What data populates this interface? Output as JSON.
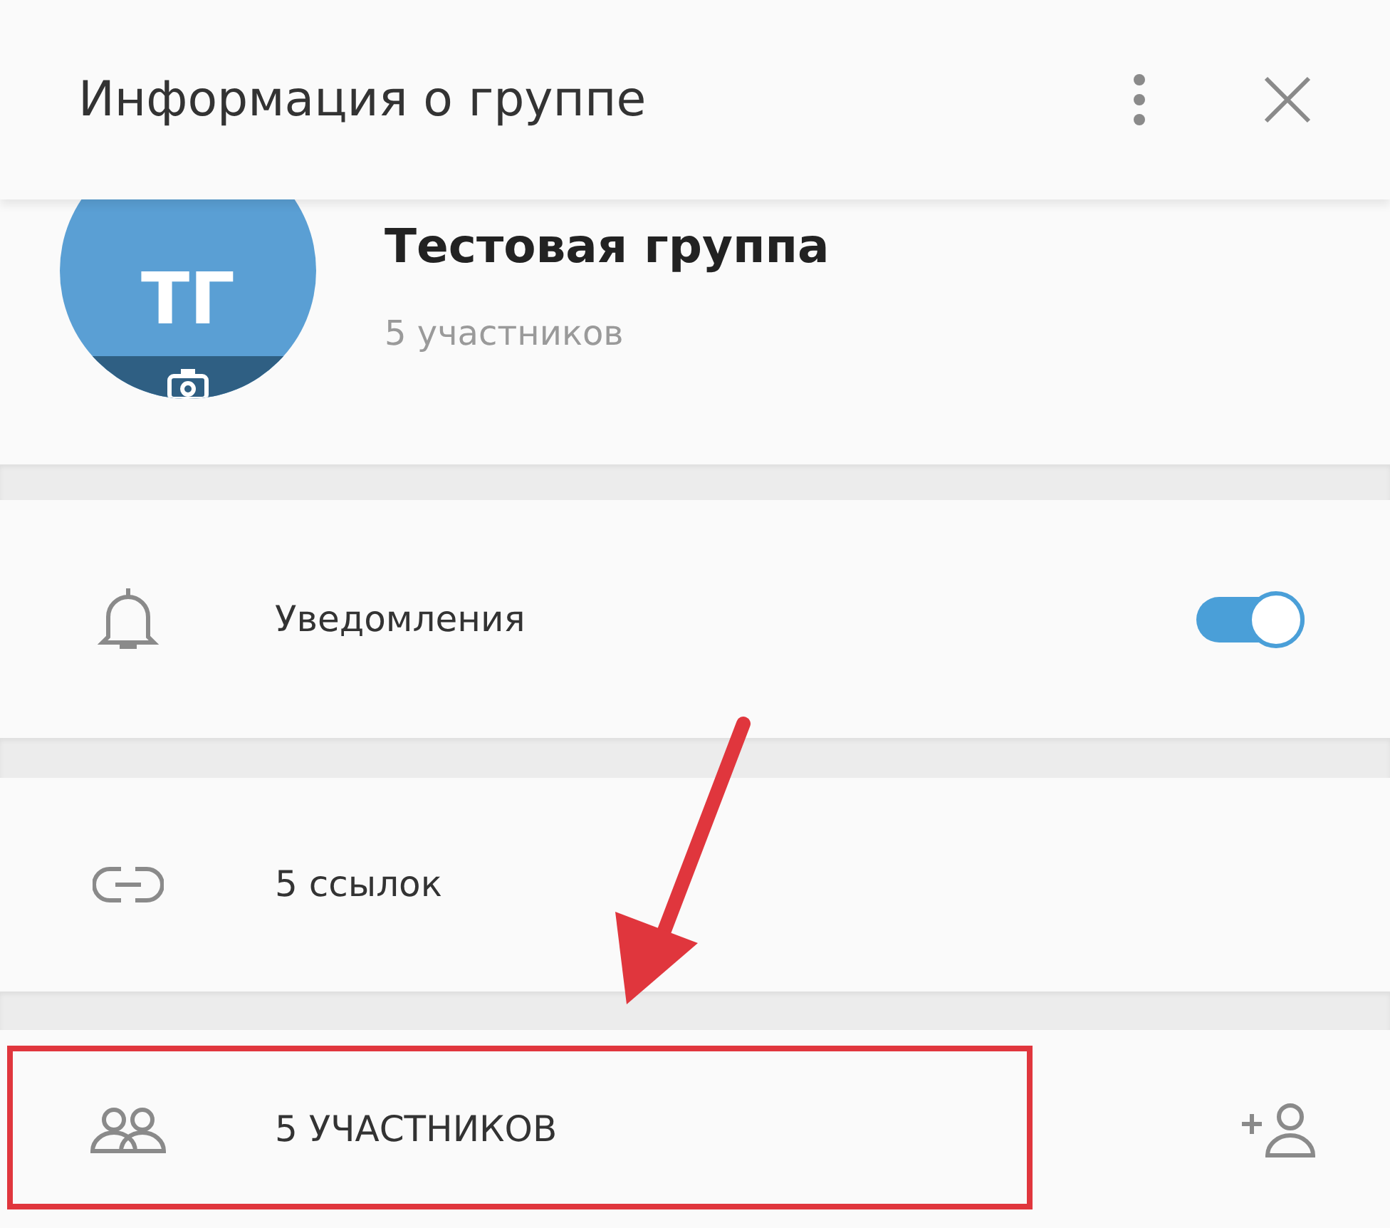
{
  "header": {
    "title": "Информация о группе"
  },
  "group": {
    "avatar_initials": "ТГ",
    "name": "Тестовая группа",
    "subtitle": "5 участников"
  },
  "rows": [
    {
      "kind": "toggle",
      "label": "Уведомления",
      "on": true,
      "highlighted": false
    },
    {
      "kind": "link",
      "label": "5 ссылок",
      "highlighted": false
    },
    {
      "kind": "members",
      "label": "5 УЧАСТНИКОВ",
      "highlighted": true
    }
  ]
}
